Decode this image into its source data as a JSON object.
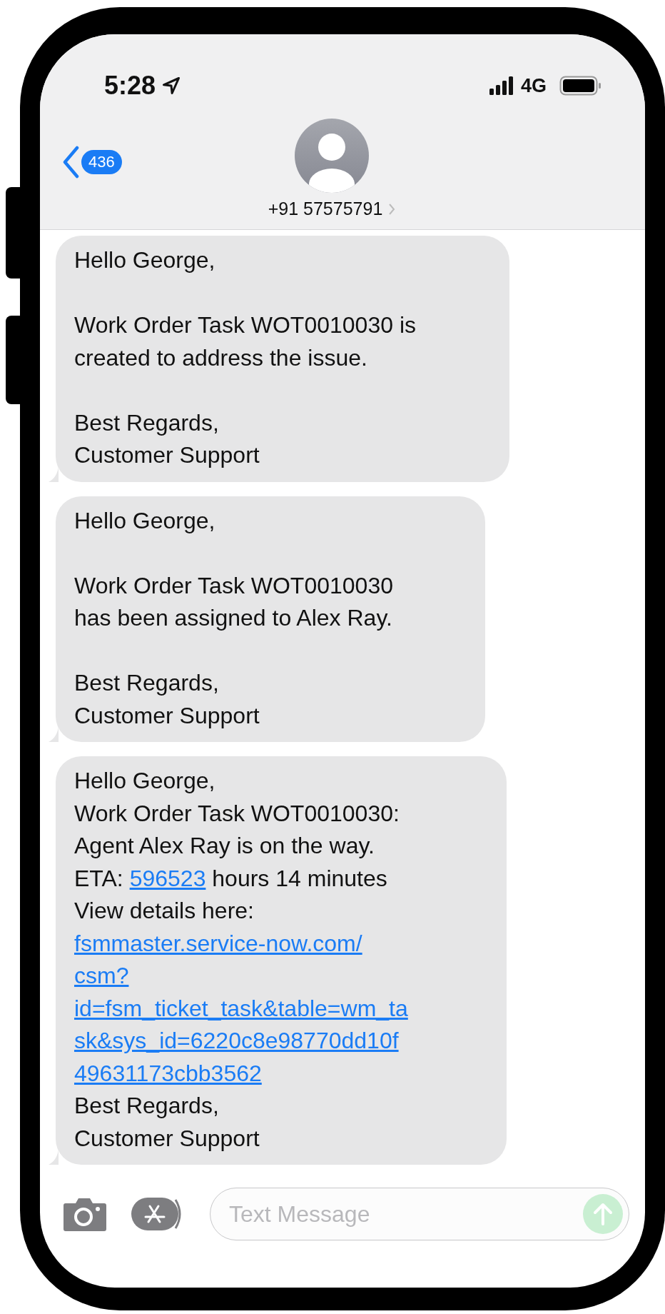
{
  "status_bar": {
    "time": "5:28",
    "network": "4G"
  },
  "header": {
    "back_badge": "436",
    "contact": "+91 57575791"
  },
  "messages": [
    {
      "parts": [
        {
          "kind": "text",
          "text": "Hello George,\n\nWork Order Task WOT0010030 is\ncreated to address the issue.\n\nBest Regards,\nCustomer Support"
        }
      ]
    },
    {
      "parts": [
        {
          "kind": "text",
          "text": "Hello George,\n\nWork Order Task WOT0010030\nhas been assigned to Alex Ray.\n\nBest Regards,\nCustomer Support"
        }
      ]
    },
    {
      "parts": [
        {
          "kind": "text",
          "text": "Hello George,\nWork Order Task WOT0010030:\nAgent Alex Ray is on the way.\nETA: "
        },
        {
          "kind": "link",
          "text": "596523"
        },
        {
          "kind": "text",
          "text": " hours 14 minutes\nView details here:"
        },
        {
          "kind": "url",
          "text": "fsmmaster.service-now.com/\ncsm?\nid=fsm_ticket_task&table=wm_ta\nsk&sys_id=6220c8e98770dd10f\n49631173cbb3562"
        },
        {
          "kind": "text",
          "text": "Best Regards,\nCustomer Support"
        }
      ]
    }
  ],
  "composer": {
    "placeholder": "Text Message"
  }
}
